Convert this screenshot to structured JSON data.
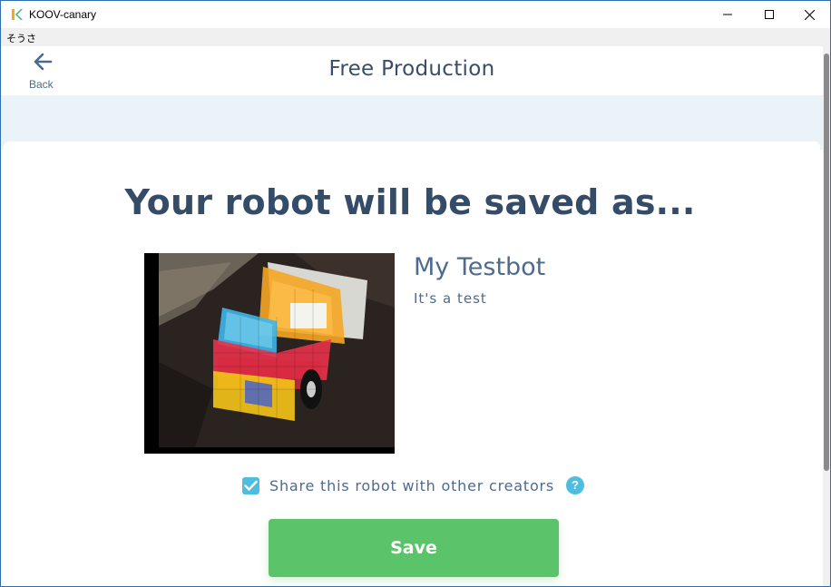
{
  "window": {
    "title": "KOOV-canary",
    "logo_icon": "koov-logo-icon",
    "controls": [
      "minimize",
      "maximize",
      "close"
    ]
  },
  "menubar": {
    "items": [
      "そうさ"
    ]
  },
  "header": {
    "back_label": "Back",
    "title": "Free Production"
  },
  "main": {
    "heading": "Your robot will be saved as...",
    "robot": {
      "name": "My Testbot",
      "description": "It's a test"
    },
    "share": {
      "label": "Share this robot with other creators",
      "checked": true,
      "help": "?"
    },
    "save_label": "Save"
  },
  "colors": {
    "accent_blue": "#4dbde0",
    "save_green": "#5bc36a",
    "heading_navy": "#354c68",
    "text_slate": "#4e6b8e",
    "band_bg": "#eaf3f7"
  }
}
